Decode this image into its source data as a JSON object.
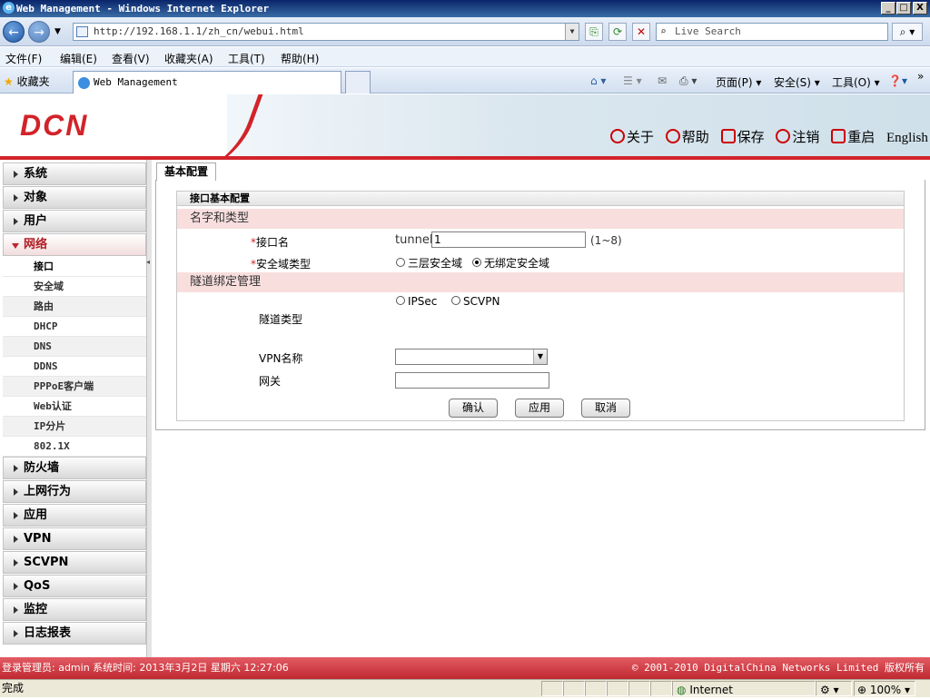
{
  "window": {
    "title": "Web Management - Windows Internet Explorer",
    "controls": [
      "_",
      "□",
      "X"
    ]
  },
  "addressbar": {
    "url": "http://192.168.1.1/zh_cn/webui.html",
    "search_placeholder": "Live Search"
  },
  "menubar": {
    "items": [
      "文件(F)",
      "编辑(E)",
      "查看(V)",
      "收藏夹(A)",
      "工具(T)",
      "帮助(H)"
    ]
  },
  "tabbar": {
    "favorites": "收藏夹",
    "tab_title": "Web Management",
    "commands": [
      "页面(P)",
      "安全(S)",
      "工具(O)"
    ]
  },
  "header": {
    "logo": "DCN",
    "links": [
      "关于",
      "帮助",
      "保存",
      "注销",
      "重启",
      "English"
    ]
  },
  "sidebar": {
    "categories_top": [
      "系统",
      "对象",
      "用户"
    ],
    "open_category": "网络",
    "sub_items": [
      "接口",
      "安全域",
      "路由",
      "DHCP",
      "DNS",
      "DDNS",
      "PPPoE客户端",
      "Web认证",
      "IP分片",
      "802.1X"
    ],
    "categories_bottom": [
      "防火墙",
      "上网行为",
      "应用",
      "VPN",
      "SCVPN",
      "QoS",
      "监控",
      "日志报表"
    ]
  },
  "content": {
    "tab": "基本配置",
    "form_title": "接口基本配置",
    "section_name_type": "名字和类型",
    "interface_name_label": "接口名",
    "interface_prefix": "tunnel",
    "interface_value": "1",
    "interface_range": "(1~8)",
    "zone_type_label": "安全域类型",
    "zone_options": [
      "三层安全域",
      "无绑定安全域"
    ],
    "zone_selected": "无绑定安全域",
    "section_tunnel": "隧道绑定管理",
    "tunnel_type_label": "隧道类型",
    "tunnel_options": [
      "IPSec",
      "SCVPN"
    ],
    "vpn_name_label": "VPN名称",
    "vpn_name_value": "",
    "gateway_label": "网关",
    "gateway_value": "",
    "required_mark": "*",
    "buttons": [
      "确认",
      "应用",
      "取消"
    ]
  },
  "footer": {
    "left": "登录管理员: admin 系统时间: 2013年3月2日 星期六 12:27:06",
    "right": "© 2001-2010 DigitalChina Networks Limited 版权所有"
  },
  "statusbar": {
    "status": "完成",
    "zone": "Internet",
    "zoom": "100%"
  }
}
